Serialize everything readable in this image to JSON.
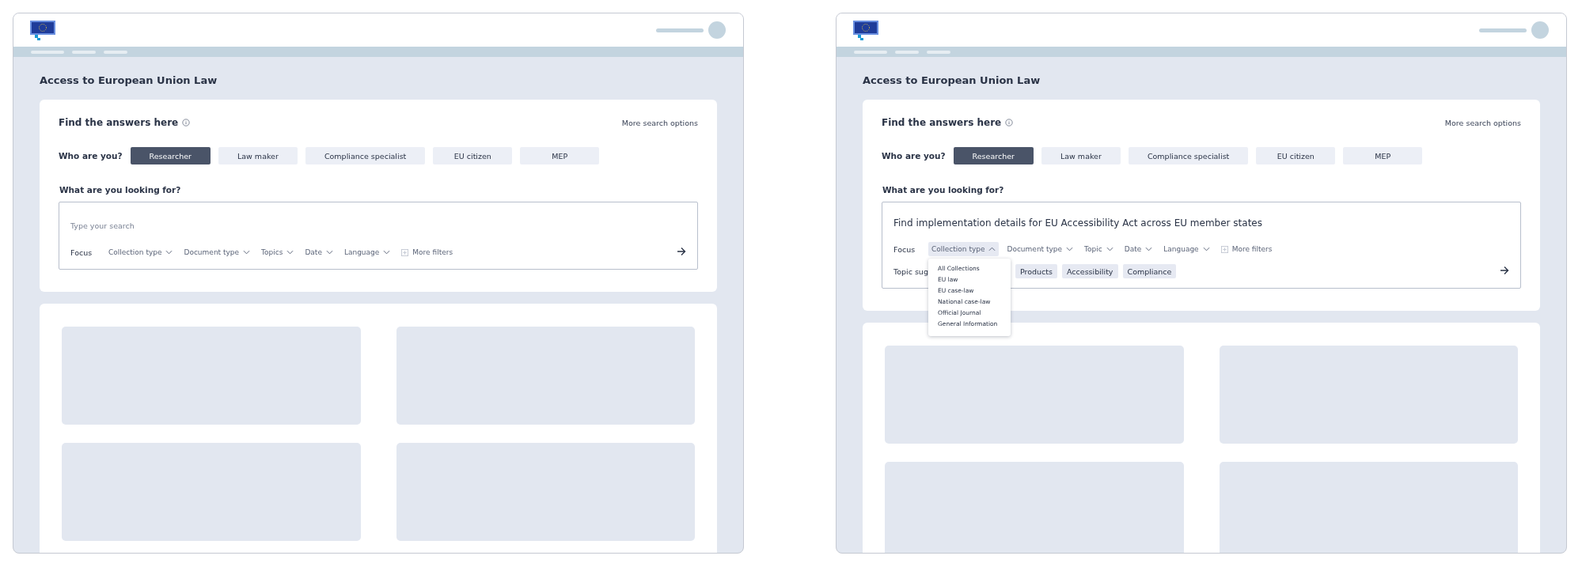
{
  "screens": [
    {
      "page_title": "Access to European Union Law",
      "search": {
        "heading": "Find the answers here",
        "more_options": "More search options",
        "persona_label": "Who are you?",
        "personas": [
          {
            "label": "Researcher",
            "selected": true
          },
          {
            "label": "Law maker",
            "selected": false
          },
          {
            "label": "Compliance specialist",
            "selected": false
          },
          {
            "label": "EU citizen",
            "selected": false
          },
          {
            "label": "MEP",
            "selected": false
          }
        ],
        "query_label": "What are you looking for?",
        "query": {
          "placeholder": "Type your search"
        },
        "focus_label": "Focus",
        "filters": [
          {
            "label": "Collection type",
            "expanded": false
          },
          {
            "label": "Document type",
            "expanded": false
          },
          {
            "label": "Topics",
            "expanded": false
          },
          {
            "label": "Date",
            "expanded": false
          },
          {
            "label": "Language",
            "expanded": false
          }
        ],
        "more_filters": "More filters"
      }
    },
    {
      "page_title": "Access to European Union Law",
      "search": {
        "heading": "Find the answers here",
        "more_options": "More search options",
        "persona_label": "Who are you?",
        "personas": [
          {
            "label": "Researcher",
            "selected": true
          },
          {
            "label": "Law maker",
            "selected": false
          },
          {
            "label": "Compliance specialist",
            "selected": false
          },
          {
            "label": "EU citizen",
            "selected": false
          },
          {
            "label": "MEP",
            "selected": false
          }
        ],
        "query_label": "What are you looking for?",
        "query": {
          "value": "Find implementation details for EU Accessibility Act across EU member states"
        },
        "focus_label": "Focus",
        "filters": [
          {
            "label": "Collection type",
            "expanded": true,
            "options": [
              "All Collections",
              "EU law",
              "EU case-law",
              "National case-law",
              "Official Journal",
              "General Information"
            ]
          },
          {
            "label": "Document type",
            "expanded": false
          },
          {
            "label": "Topic",
            "expanded": false
          },
          {
            "label": "Date",
            "expanded": false
          },
          {
            "label": "Language",
            "expanded": false
          }
        ],
        "more_filters": "More filters",
        "topic_suggestions": {
          "label": "Topic sug",
          "chips": [
            "Products",
            "Accessibility",
            "Compliance"
          ]
        }
      }
    }
  ]
}
